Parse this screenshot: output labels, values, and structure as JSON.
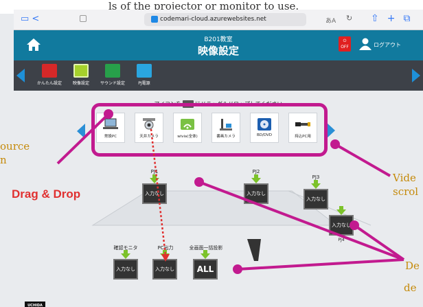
{
  "caption_top": "ls of the projector or monitor to use.",
  "browser": {
    "url": "codemari-cloud.azurewebsites.net",
    "text_size_label": "あA"
  },
  "header": {
    "room": "B201教室",
    "title": "映像設定",
    "power_label": "OFF",
    "logout_label": "ログアウト"
  },
  "nav": {
    "items": [
      {
        "label": "かんたん設定",
        "color": "#d62828"
      },
      {
        "label": "映像設定",
        "color": "#a6d12c"
      },
      {
        "label": "サウンド設定",
        "color": "#27a04a"
      },
      {
        "label": "PJ電源",
        "color": "#2aa6e0"
      }
    ]
  },
  "sources": {
    "instruction_prefix": "アイコンを",
    "instruction_suffix": "にドラッグ＆ドロップしてください",
    "items": [
      {
        "label": "常設PC"
      },
      {
        "label": "天井カメラ"
      },
      {
        "label": "wivia(全体)"
      },
      {
        "label": "書画カメラ"
      },
      {
        "label": "BD/DVD"
      },
      {
        "label": "持込PC用"
      }
    ]
  },
  "destinations": [
    {
      "name": "PJ1",
      "value": "入力なし"
    },
    {
      "name": "PJ2",
      "value": "入力なし"
    },
    {
      "name": "PJ3",
      "value": "入力なし"
    },
    {
      "name": "PJ4",
      "value": "入力なし"
    },
    {
      "name": "確認モニタ",
      "value": "入力なし"
    },
    {
      "name": "PC出力",
      "value": "入力なし"
    },
    {
      "name": "全画面一括投影",
      "value": "ALL"
    }
  ],
  "annotations": {
    "source_line1": "ource",
    "source_line2": "n",
    "video_line1": "Vide",
    "video_line2": "scrol",
    "dest_line1": "De",
    "dest_line2": "de",
    "drag_drop": "Drag & Drop"
  },
  "brand": "UCHIDA",
  "colors": {
    "header": "#117a9e",
    "accent_magenta": "#c21a8f",
    "drag_red": "#e03030",
    "arrow_green": "#7cc22a"
  }
}
